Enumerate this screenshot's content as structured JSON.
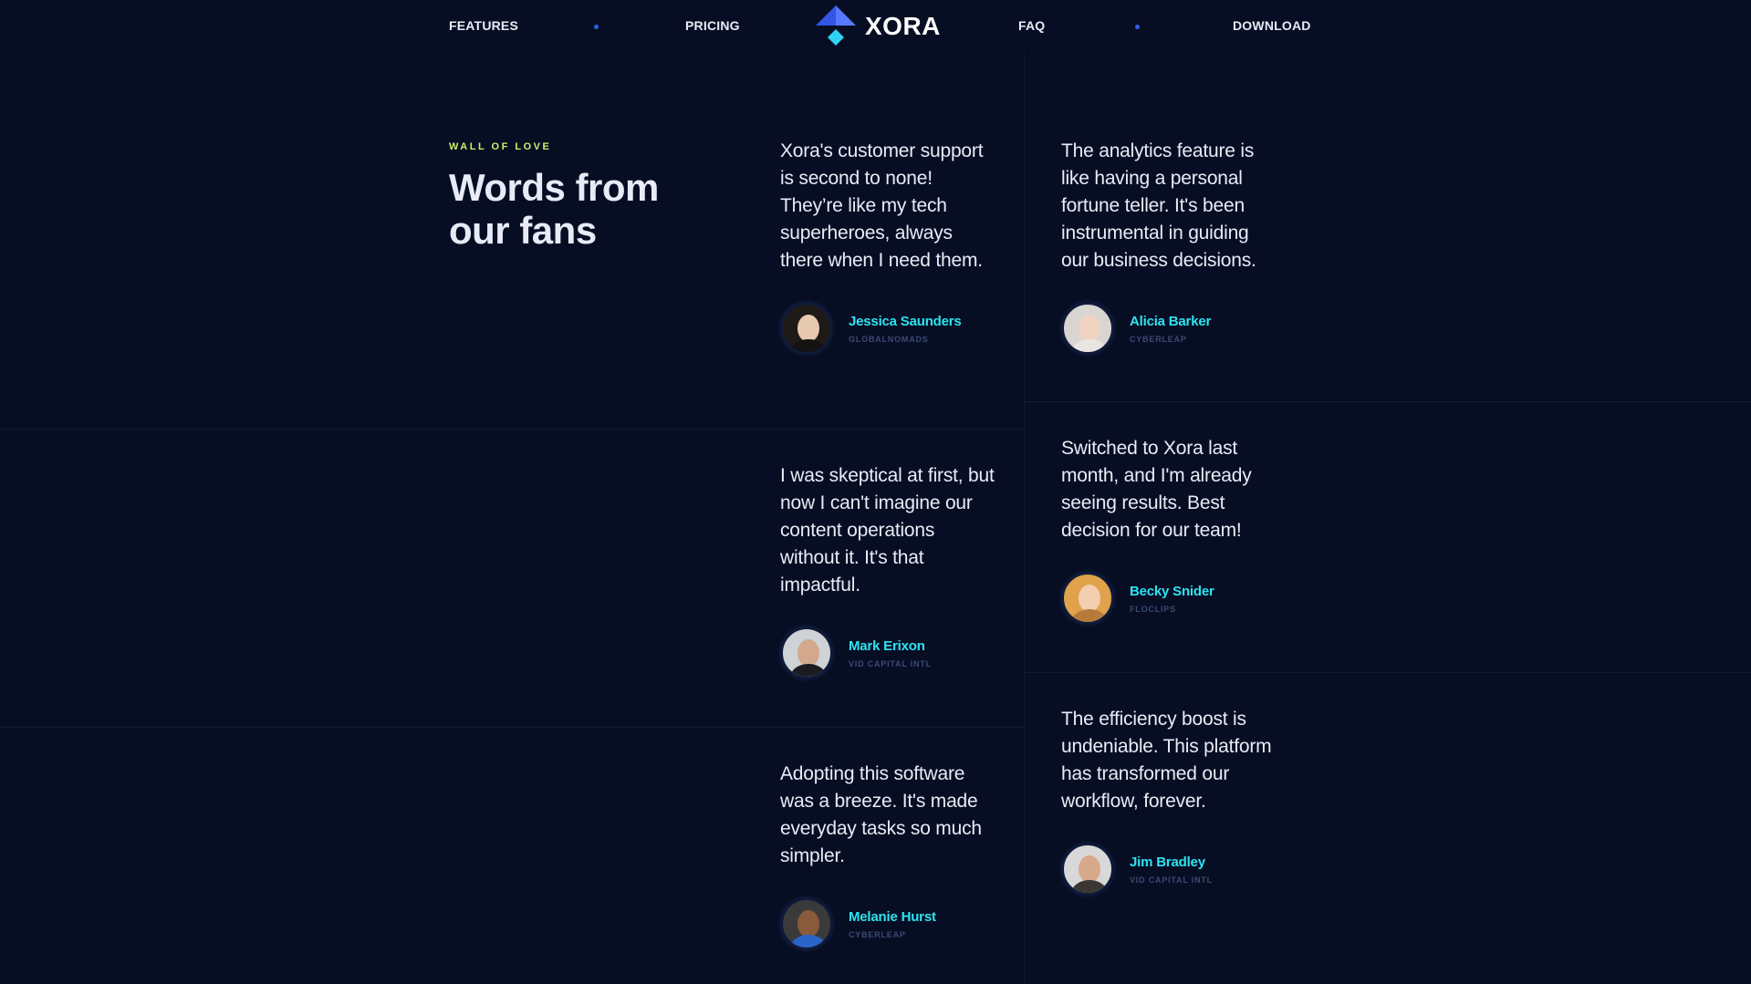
{
  "nav": {
    "left": [
      "FEATURES",
      "PRICING"
    ],
    "right": [
      "FAQ",
      "DOWNLOAD"
    ],
    "logo_text": "XORA"
  },
  "section": {
    "eyebrow": "WALL OF LOVE",
    "title": "Words from our fans"
  },
  "testimonials": [
    {
      "quote": "Xora's customer support is second to none! They’re like my tech superheroes, always there when I need them.",
      "name": "Jessica Saunders",
      "company": "GLOBALNOMADS"
    },
    {
      "quote": "The analytics feature is like having a personal fortune teller. It's been instrumental in guiding our business decisions.",
      "name": "Alicia Barker",
      "company": "CYBERLEAP"
    },
    {
      "quote": "I was skeptical at first, but now I can't imagine our content operations without it. It's that impactful.",
      "name": "Mark Erixon",
      "company": "VID CAPITAL INTL"
    },
    {
      "quote": "Switched to Xora last month, and I'm already seeing results. Best decision for our team!",
      "name": "Becky Snider",
      "company": "FLOCLIPS"
    },
    {
      "quote": "Adopting this software was a breeze. It's made everyday tasks so much simpler.",
      "name": "Melanie Hurst",
      "company": "CYBERLEAP"
    },
    {
      "quote": "The efficiency boost is undeniable. This platform has transformed our workflow, forever.",
      "name": "Jim Bradley",
      "company": "VID CAPITAL INTL"
    }
  ],
  "colors": {
    "background": "#070e24",
    "accent_name": "#2ee3f0",
    "eyebrow": "#c7f06a",
    "logo_primary": "#3a5bf0",
    "logo_secondary": "#2fd2f5"
  }
}
